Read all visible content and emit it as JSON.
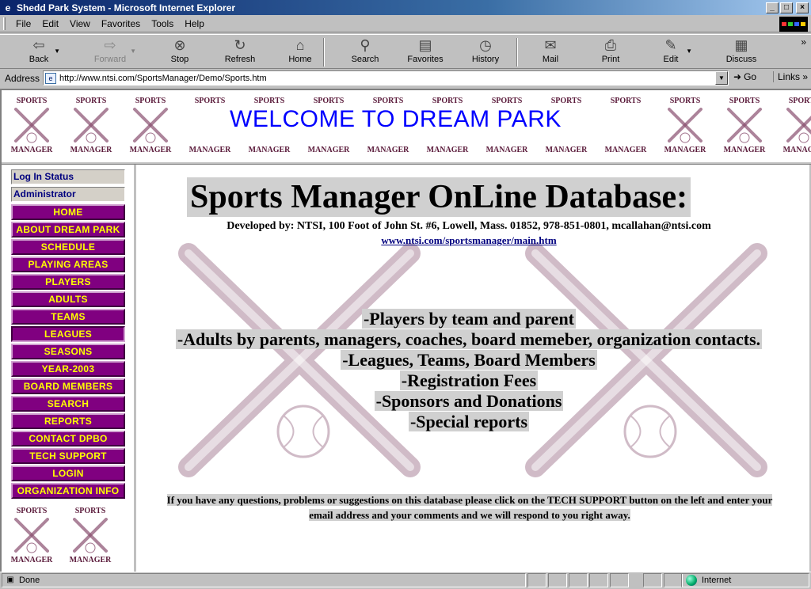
{
  "window": {
    "title": "Shedd Park System - Microsoft Internet Explorer",
    "minimize": "_",
    "maximize": "□",
    "close": "×"
  },
  "menu": [
    "File",
    "Edit",
    "View",
    "Favorites",
    "Tools",
    "Help"
  ],
  "toolbar": [
    {
      "label": "Back",
      "icon": "back-arrow-icon",
      "enabled": true
    },
    {
      "label": "Forward",
      "icon": "forward-arrow-icon",
      "enabled": false
    },
    {
      "label": "Stop",
      "icon": "stop-icon",
      "enabled": true
    },
    {
      "label": "Refresh",
      "icon": "refresh-icon",
      "enabled": true
    },
    {
      "label": "Home",
      "icon": "home-icon",
      "enabled": true
    },
    {
      "label": "Search",
      "icon": "search-icon",
      "enabled": true
    },
    {
      "label": "Favorites",
      "icon": "favorites-icon",
      "enabled": true
    },
    {
      "label": "History",
      "icon": "history-icon",
      "enabled": true
    },
    {
      "label": "Mail",
      "icon": "mail-icon",
      "enabled": true
    },
    {
      "label": "Print",
      "icon": "print-icon",
      "enabled": true
    },
    {
      "label": "Edit",
      "icon": "edit-icon",
      "enabled": true
    },
    {
      "label": "Discuss",
      "icon": "discuss-icon",
      "enabled": true
    }
  ],
  "address": {
    "label": "Address",
    "url": "http://www.ntsi.com/SportsManager/Demo/Sports.htm",
    "go": "Go",
    "links": "Links",
    "chevron": "»"
  },
  "banner": {
    "logo_top": "SPORTS",
    "logo_bottom": "MANAGER",
    "welcome": "WELCOME TO DREAM PARK"
  },
  "nav": {
    "log_in_status": "Log In Status",
    "user": "Administrator",
    "items": [
      "HOME",
      "ABOUT DREAM PARK",
      "SCHEDULE",
      "PLAYING AREAS",
      "PLAYERS",
      "ADULTS",
      "TEAMS",
      "LEAGUES",
      "SEASONS",
      "YEAR-2003",
      "BOARD MEMBERS",
      "SEARCH",
      "REPORTS",
      "CONTACT DPBO",
      "TECH SUPPORT",
      "LOGIN",
      "ORGANIZATION INFO"
    ],
    "active_item": "LEAGUES"
  },
  "main": {
    "title": "Sports Manager OnLine Database:",
    "developed_by": "Developed by: NTSI, 100 Foot of John St. #6, Lowell, Mass. 01852, 978-851-0801, mcallahan@ntsi.com",
    "link": "www.ntsi.com/sportsmanager/main.htm",
    "features": [
      "-Players by team and parent",
      "-Adults by parents, managers, coaches, board memeber, organization contacts.",
      "-Leagues, Teams, Board Members",
      "-Registration Fees",
      "-Sponsors and Donations",
      "-Special reports"
    ],
    "note": "If you have any questions, problems or suggestions on this database please click on the TECH SUPPORT button on the left and enter your email address and your comments and we will respond to you right away."
  },
  "statusbar": {
    "status": "Done",
    "zone": "Internet"
  },
  "colors": {
    "nav_bg": "#800080",
    "nav_text": "#ffff00",
    "welcome": "#0000ff",
    "logo": "#5a1a3a"
  }
}
